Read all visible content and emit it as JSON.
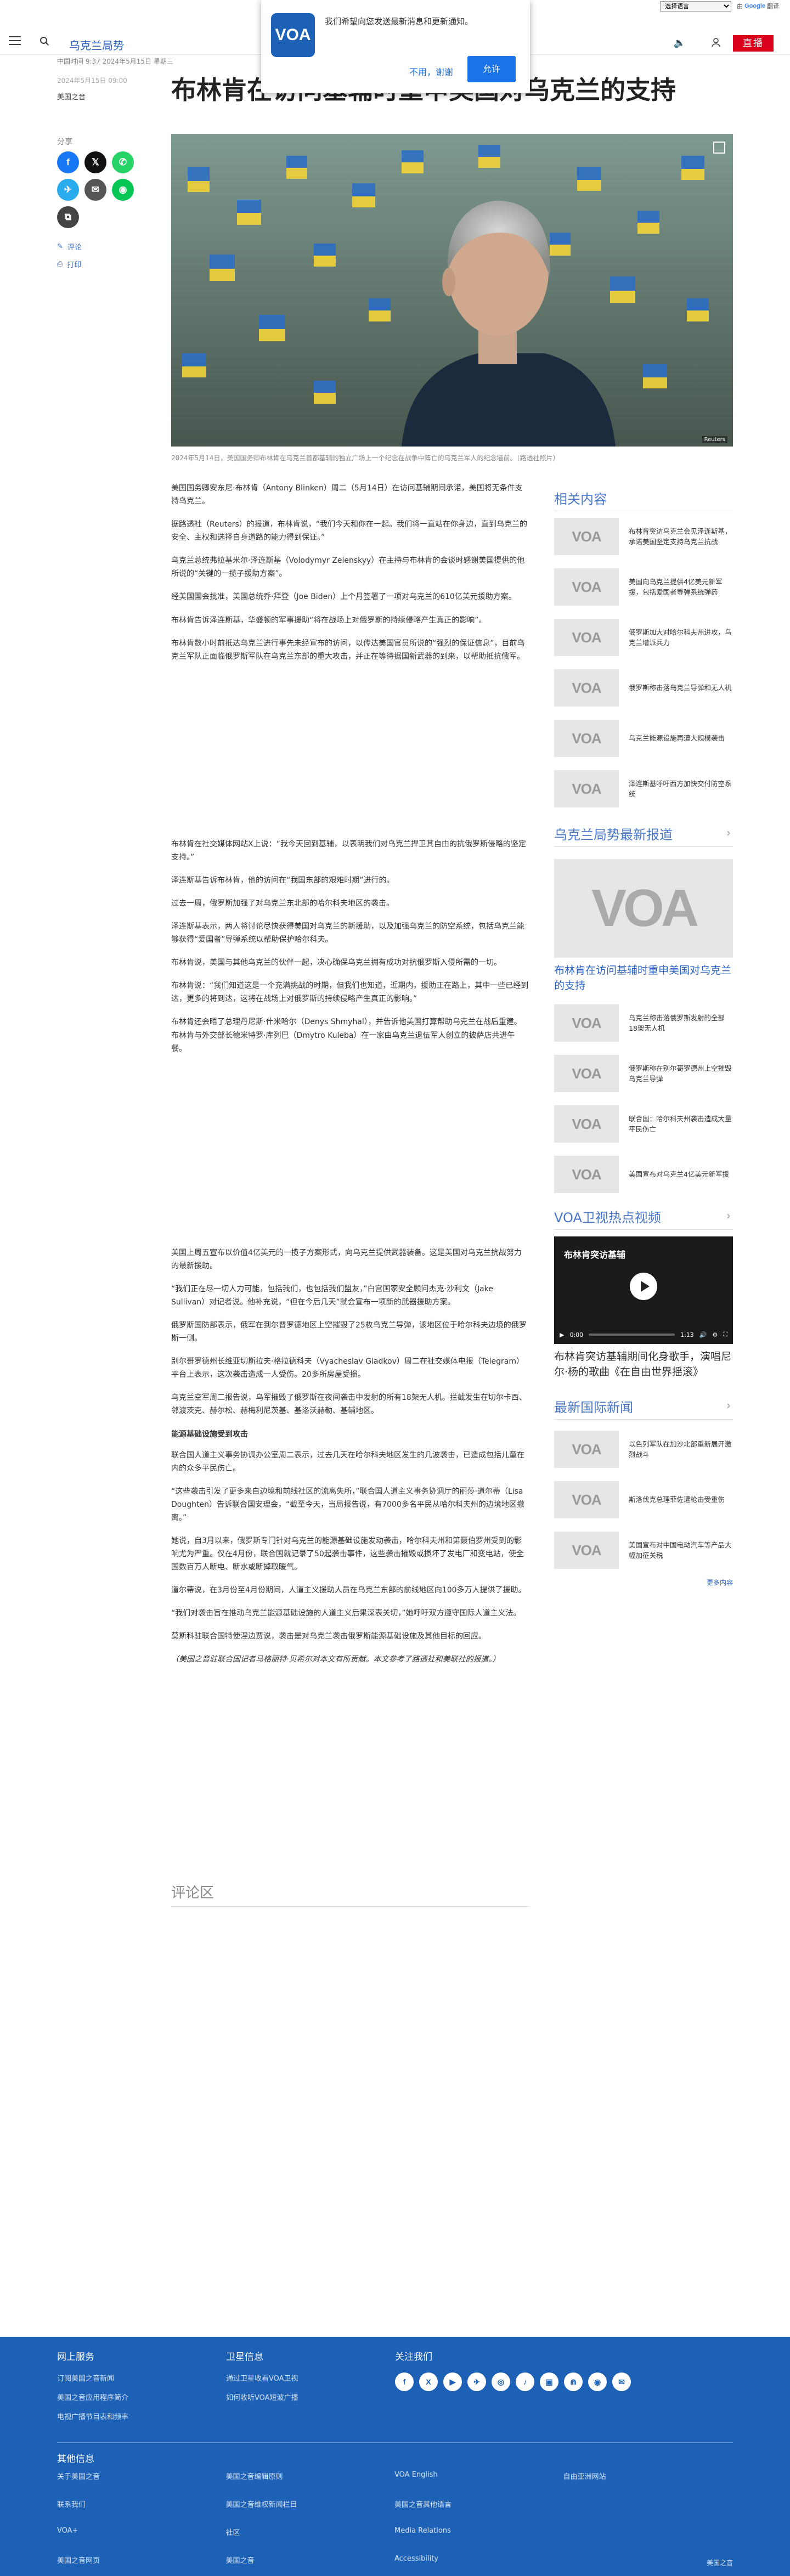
{
  "lang_bar": {
    "selected": "选择语言",
    "powered_by": "由",
    "google": "Google",
    "translate": "翻译"
  },
  "header": {
    "section": "乌克兰局势",
    "live": "直播"
  },
  "notice": {
    "message": "我们希望向您发送最新消息和更新通知。",
    "decline": "不用，谢谢",
    "accept": "允许",
    "logo": "VOA"
  },
  "article_meta": {
    "dateline": "中国时间 9:37 2024年5月15日 星期三",
    "published": "2024年5月15日 09:00",
    "byline": "美国之音"
  },
  "headline": "布林肯在访问基辅时重申美国对乌克兰的支持",
  "share": {
    "label": "分享",
    "comments": "评论",
    "print": "打印"
  },
  "hero_caption": "2024年5月14日，美国国务卿布林肯在乌克兰首都基辅的独立广场上一个纪念在战争中阵亡的乌克兰军人的纪念墙前。（路透社照片）",
  "hero_credit": "Reuters",
  "article_paragraphs_1": [
    "美国国务卿安东尼·布林肯（Antony Blinken）周二（5月14日）在访问基辅期间承诺，美国将无条件支持乌克兰。",
    "据路透社（Reuters）的报道，布林肯说，“我们今天和你在一起。我们将一直站在你身边，直到乌克兰的安全、主权和选择自身道路的能力得到保证。”",
    "乌克兰总统弗拉基米尔·泽连斯基（Volodymyr Zelenskyy）在主持与布林肯的会谈时感谢美国提供的他所说的“关键的一揽子援助方案”。",
    "经美国国会批准，美国总统乔·拜登（Joe Biden）上个月签署了一项对乌克兰的610亿美元援助方案。",
    "布林肯告诉泽连斯基，华盛顿的军事援助“将在战场上对俄罗斯的持续侵略产生真正的影响”。",
    "布林肯数小时前抵达乌克兰进行事先未经宣布的访问，以传达美国官员所说的“强烈的保证信息”，目前乌克兰军队正面临俄罗斯军队在乌克兰东部的重大攻击，并正在等待据国新武器的到来，以帮助抵抗俄军。"
  ],
  "article_paragraphs_2": [
    "布林肯在社交媒体网站X上说：“我今天回到基辅，以表明我们对乌克兰捍卫其自由的抗俄罗斯侵略的坚定支持。”",
    "泽连斯基告诉布林肯，他的访问在“我国东部的艰难时期”进行的。",
    "过去一周，俄罗斯加强了对乌克兰东北部的哈尔科夫地区的袭击。",
    "泽连斯基表示，两人将讨论尽快获得美国对乌克兰的新援助，以及加强乌克兰的防空系统，包括乌克兰能够获得“爱国者”导弹系统以帮助保护哈尔科夫。",
    "布林肯说，美国与其他乌克兰的伙伴一起，决心确保乌克兰拥有成功对抗俄罗斯入侵所需的一切。",
    "布林肯说：“我们知道这是一个充满挑战的时期，但我们也知道，近期内，援助正在路上，其中一些已经到达，更多的将到达，这将在战场上对俄罗斯的持续侵略产生真正的影响。”",
    "布林肯还会晤了总理丹尼斯·什米哈尔（Denys Shmyhal），并告诉他美国打算帮助乌克兰在战后重建。布林肯与外交部长德米特罗·库列巴（Dmytro Kuleba）在一家由乌克兰退伍军人创立的披萨店共进午餐。"
  ],
  "article_paragraphs_3": [
    "美国上周五宣布以价值4亿美元的一揽子方案形式，向乌克兰提供武器装备。这是美国对乌克兰抗战努力的最新援助。",
    "“我们正在尽一切人力可能，包括我们，也包括我们盟友，”白宫国家安全顾问杰克·沙利文（Jake Sullivan）对记者说。他补充说，“但在今后几天”就会宣布一项新的武器援助方案。",
    "俄罗斯国防部表示，俄军在到尔普罗德地区上空摧毁了25枚乌克兰导弹，该地区位于哈尔科夫边境的俄罗斯一侧。",
    "别尔哥罗德州长维亚切斯拉夫·格拉德科夫（Vyacheslav Gladkov）周二在社交媒体电报（Telegram）平台上表示，这次袭击造成一人受伤。20多所房屋受损。",
    "乌克兰空军周二报告说，乌军摧毁了俄罗斯在夜间袭击中发射的所有18架无人机。拦截发生在切尔卡西、邻渡茨克、赫尔松、赫梅利尼茨基、基洛沃赫勒、基辅地区。"
  ],
  "energy_heading": "能源基础设施受到攻击",
  "article_paragraphs_4": [
    "联合国人道主义事务协调办公室周二表示，过去几天在哈尔科夫地区发生的几波袭击，已造成包括儿童在内的众多平民伤亡。",
    "“这些袭击引发了更多来自边境和前线社区的流离失所，”联合国人道主义事务协调厅的丽莎·道尔蒂（Lisa Doughten）告诉联合国安理会，“截至今天，当局报告说，有7000多名平民从哈尔科夫州的边境地区撤离。”",
    "她说，自3月以来，俄罗斯专门针对乌克兰的能源基础设施发动袭击，哈尔科夫州和第聂伯罗州受到的影响尤为严重。仅在4月份，联合国就记录了50起袭击事件，这些袭击摧毁或损坏了发电厂和变电站，使全国数百万人断电、断水或断掉取暖气。",
    "道尔蒂说，在3月份至4月份期间，人道主义援助人员在乌克兰东部的前线地区向100多万人提供了援助。",
    "“我们对袭击旨在推动乌克兰能源基础设施的人道主义后果深表关切，”她呼吁双方遵守国际人道主义法。",
    "莫斯科驻联合国特使涅边贾说，袭击是对乌克兰袭击俄罗斯能源基础设施及其他目标的回应。",
    "（美国之音驻联合国记者马格丽特·贝希尔对本文有所贡献。本文参考了路透社和美联社的报道。）"
  ],
  "comments_title": "评论区",
  "related": {
    "title": "相关内容",
    "items": [
      "布林肯突访乌克兰会见泽连斯基，承诺美国坚定支持乌克兰抗战",
      "美国向乌克兰提供4亿美元新军援，包括爱国者导弹系统弹药",
      "俄罗斯加大对哈尔科夫州进攻，乌克兰增派兵力",
      "俄罗斯称击落乌克兰导弹和无人机",
      "乌克兰能源设施再遭大规模袭击",
      "泽连斯基呼吁西方加快交付防空系统"
    ]
  },
  "ukraine_block": {
    "title": "乌克兰局势最新报道",
    "big_headline": "布林肯在访问基辅时重申美国对乌克兰的支持",
    "items": [
      "乌克兰称击落俄罗斯发射的全部18架无人机",
      "俄罗斯称在别尔哥罗德州上空摧毁乌克兰导弹",
      "联合国：哈尔科夫州袭击造成大量平民伤亡",
      "美国宣布对乌克兰4亿美元新军援"
    ]
  },
  "video_block": {
    "title": "VOA卫视热点视频",
    "video_title": "布林肯突访基辅",
    "time": "0:00",
    "duration": "1:13",
    "caption": "布林肯突访基辅期间化身歌手，演唱尼尔·杨的歌曲《在自由世界摇滚》"
  },
  "intl_block": {
    "title": "最新国际新闻",
    "items": [
      "以色列军队在加沙北部重新展开激烈战斗",
      "斯洛伐克总理菲佐遭枪击受重伤",
      "美国宣布对中国电动汽车等产品大幅加征关税"
    ],
    "more": "更多内容"
  },
  "footer": {
    "col1_title": "网上服务",
    "col1_links": [
      "订阅美国之音新闻",
      "美国之音应用程序简介",
      "电视广播节目表和频率"
    ],
    "col2_title": "卫星信息",
    "col2_links": [
      "通过卫星收看VOA卫视",
      "如何收听VOA短波广播"
    ],
    "col3_title": "关注我们",
    "social": [
      "f",
      "X",
      "▶",
      "✈",
      "◎",
      "♪",
      "▣",
      "⋒",
      "◉",
      "✉"
    ],
    "other_title": "其他信息",
    "grid_links": [
      "关于美国之音",
      "美国之音编辑原则",
      "VOA English",
      "自由亚洲网站",
      "联系我们",
      "美国之音维权新闻栏目",
      "美国之音其他语言",
      "",
      "VOA+",
      "社区",
      "Media Relations",
      "",
      "美国之音网页",
      "美国之音",
      "Accessibility",
      ""
    ],
    "copyright": "美国之音"
  }
}
